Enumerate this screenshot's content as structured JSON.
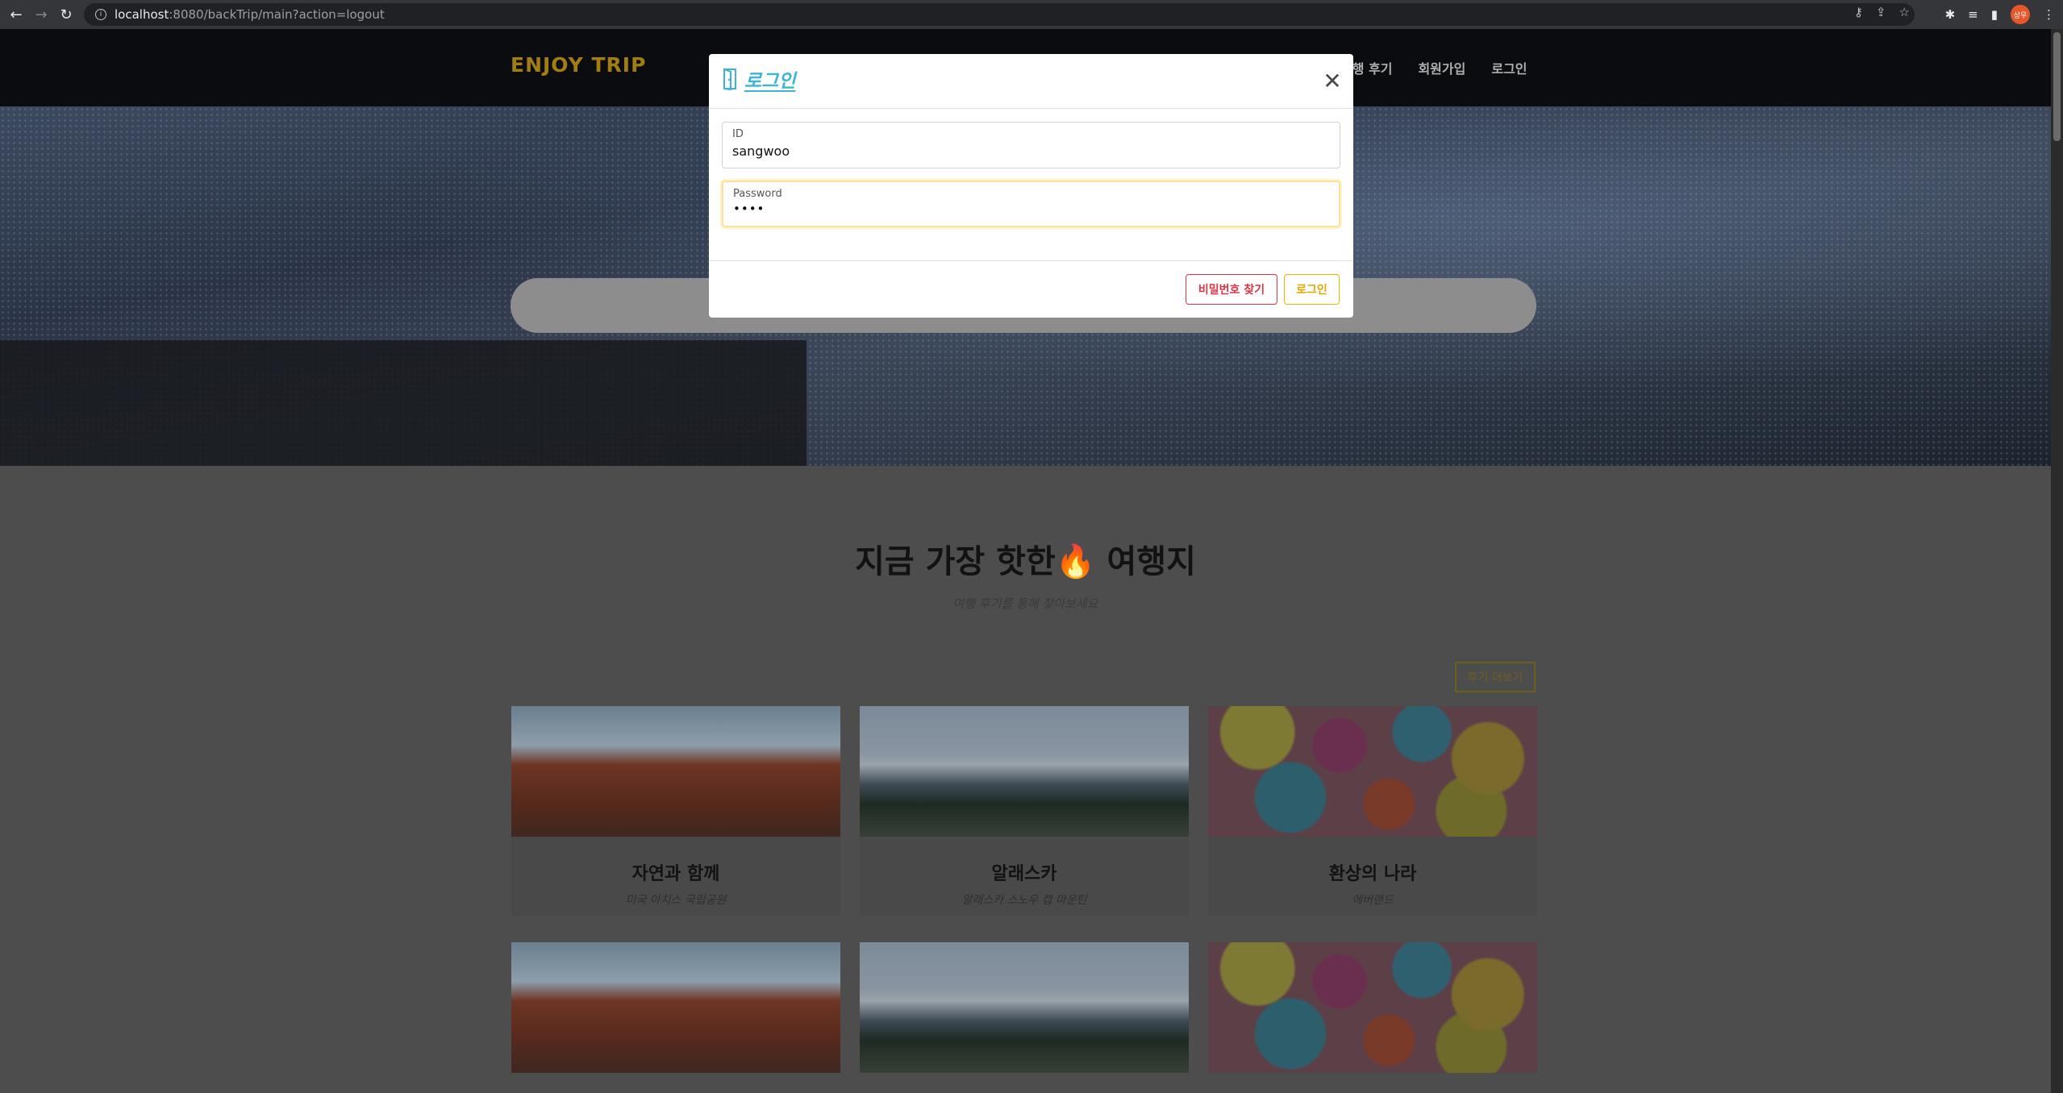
{
  "browser": {
    "url_host": "localhost",
    "url_rest": ":8080/backTrip/main?action=logout",
    "profile_initials": "상우"
  },
  "site": {
    "logo": "ENJOY TRIP",
    "nav": [
      "여행 후기",
      "회원가입",
      "로그인"
    ]
  },
  "hot": {
    "title": "지금 가장 핫한🔥 여행지",
    "subtitle": "여행 후기를 통해 찾아보세요",
    "more_label": "후기 더보기"
  },
  "cards": [
    {
      "title": "자연과 함께",
      "subtitle": "미국 아치스 국립공원"
    },
    {
      "title": "알래스카",
      "subtitle": "알래스카 스노우 캡 마운틴"
    },
    {
      "title": "환상의 나라",
      "subtitle": "에버랜드"
    }
  ],
  "modal": {
    "title": "로그인",
    "close_symbol": "✕",
    "id_label": "ID",
    "id_value": "sangwoo",
    "password_label": "Password",
    "password_value": "••••",
    "find_password_label": "비밀번호 찾기",
    "login_label": "로그인"
  },
  "colors": {
    "accent_cyan": "#3bb4d8",
    "logo_gold": "#a27e12",
    "danger": "#dc3545",
    "warning": "#f0b400"
  }
}
